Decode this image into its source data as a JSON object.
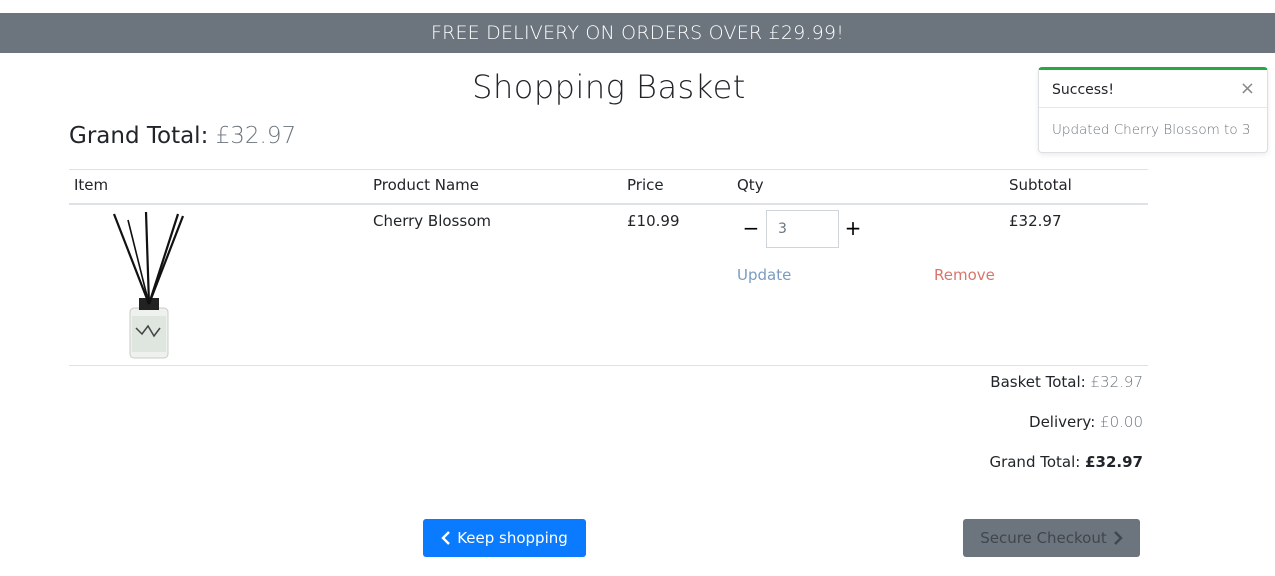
{
  "banner": {
    "text": "FREE DELIVERY ON ORDERS OVER £29.99!"
  },
  "page": {
    "title": "Shopping Basket",
    "grand_total_label": "Grand Total:",
    "grand_total_value": "£32.97"
  },
  "table": {
    "headers": [
      "Item",
      "Product Name",
      "Price",
      "Qty",
      "Subtotal"
    ],
    "rows": [
      {
        "image_icon": "reed-diffuser-image",
        "product_name": "Cherry Blossom",
        "price": "£10.99",
        "qty": "3",
        "subtotal": "£32.97",
        "update_label": "Update",
        "remove_label": "Remove",
        "minus_symbol": "−",
        "plus_symbol": "+"
      }
    ]
  },
  "summary": {
    "basket_total_label": "Basket Total:",
    "basket_total_value": "£32.97",
    "delivery_label": "Delivery:",
    "delivery_value": "£0.00",
    "grand_total_label": "Grand Total:",
    "grand_total_value": "£32.97"
  },
  "buttons": {
    "keep_shopping": "Keep shopping",
    "secure_checkout": "Secure Checkout"
  },
  "toast": {
    "title": "Success!",
    "close_symbol": "×",
    "message": "Updated Cherry Blossom to 3"
  },
  "colors": {
    "banner": "#6c757d",
    "primary_button": "#0a7bff",
    "checkout_button": "#6c757d",
    "toast_accent": "#28a745",
    "update_link": "#7a9cc1",
    "remove_link": "#d9756b"
  }
}
